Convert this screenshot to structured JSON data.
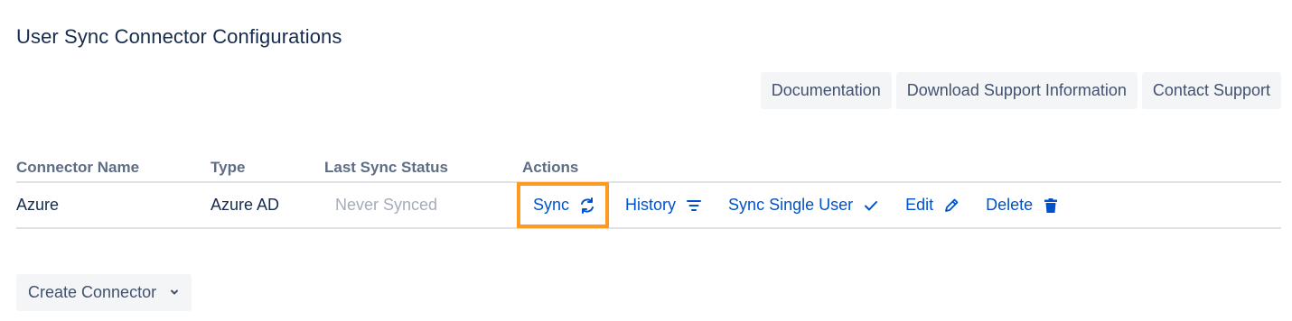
{
  "page": {
    "title": "User Sync Connector Configurations"
  },
  "top_actions": {
    "documentation": "Documentation",
    "download_support": "Download Support Information",
    "contact_support": "Contact Support"
  },
  "table": {
    "headers": [
      "Connector Name",
      "Type",
      "Last Sync Status",
      "Actions"
    ],
    "rows": [
      {
        "name": "Azure",
        "type": "Azure AD",
        "status": "Never Synced"
      }
    ]
  },
  "row_actions": {
    "sync": "Sync",
    "history": "History",
    "sync_single_user": "Sync Single User",
    "edit": "Edit",
    "delete": "Delete"
  },
  "icons": {
    "sync": "refresh-icon",
    "history": "filter-lines-icon",
    "sync_single_user": "check-icon",
    "edit": "pencil-icon",
    "delete": "trash-icon",
    "create": "chevron-down-icon"
  },
  "colors": {
    "link": "#0052cc",
    "highlight": "#ff991f",
    "button_bg": "#f4f5f7",
    "muted": "#a5adba"
  },
  "create_button": {
    "label": "Create Connector"
  }
}
